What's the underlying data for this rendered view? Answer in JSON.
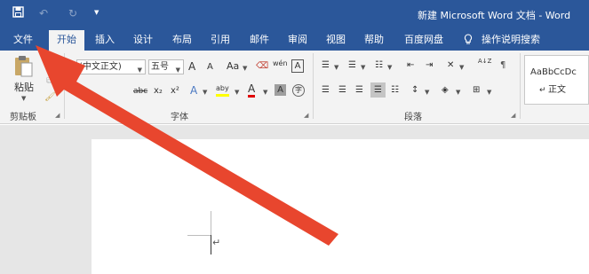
{
  "window": {
    "title": "新建 Microsoft Word 文档 - Word"
  },
  "quick_access": {
    "save_icon": "save-icon",
    "undo_icon": "undo-icon",
    "redo_icon": "redo-icon",
    "customize_icon": "dropdown-icon"
  },
  "tabs": [
    {
      "label": "文件"
    },
    {
      "label": "开始"
    },
    {
      "label": "插入"
    },
    {
      "label": "设计"
    },
    {
      "label": "布局"
    },
    {
      "label": "引用"
    },
    {
      "label": "邮件"
    },
    {
      "label": "审阅"
    },
    {
      "label": "视图"
    },
    {
      "label": "帮助"
    },
    {
      "label": "百度网盘"
    },
    {
      "label": "操作说明搜索"
    }
  ],
  "active_tab": "开始",
  "ribbon": {
    "clipboard": {
      "paste_label": "粘贴",
      "group_label": "剪贴板"
    },
    "font": {
      "font_name": "(中文正文)",
      "font_size": "五号",
      "grow": "A",
      "shrink": "A",
      "case": "Aa",
      "phonetic": "wén",
      "border_char": "A",
      "bold": "B",
      "strike": "abc",
      "subscript": "x₂",
      "superscript": "x²",
      "effects": "A",
      "highlight": "aby",
      "font_color": "A",
      "shading": "A",
      "enclose": "字",
      "group_label": "字体"
    },
    "paragraph": {
      "sort": "A↓Z",
      "group_label": "段落"
    },
    "styles": {
      "preview": "AaBbCcDc",
      "name": "正文"
    }
  },
  "document": {
    "paragraph_mark": "↵"
  },
  "colors": {
    "title_bar": "#2b579a",
    "ribbon": "#f3f3f3",
    "arrow": "#e8462e",
    "highlight": "#ffff00",
    "font_color": "#e00000"
  }
}
